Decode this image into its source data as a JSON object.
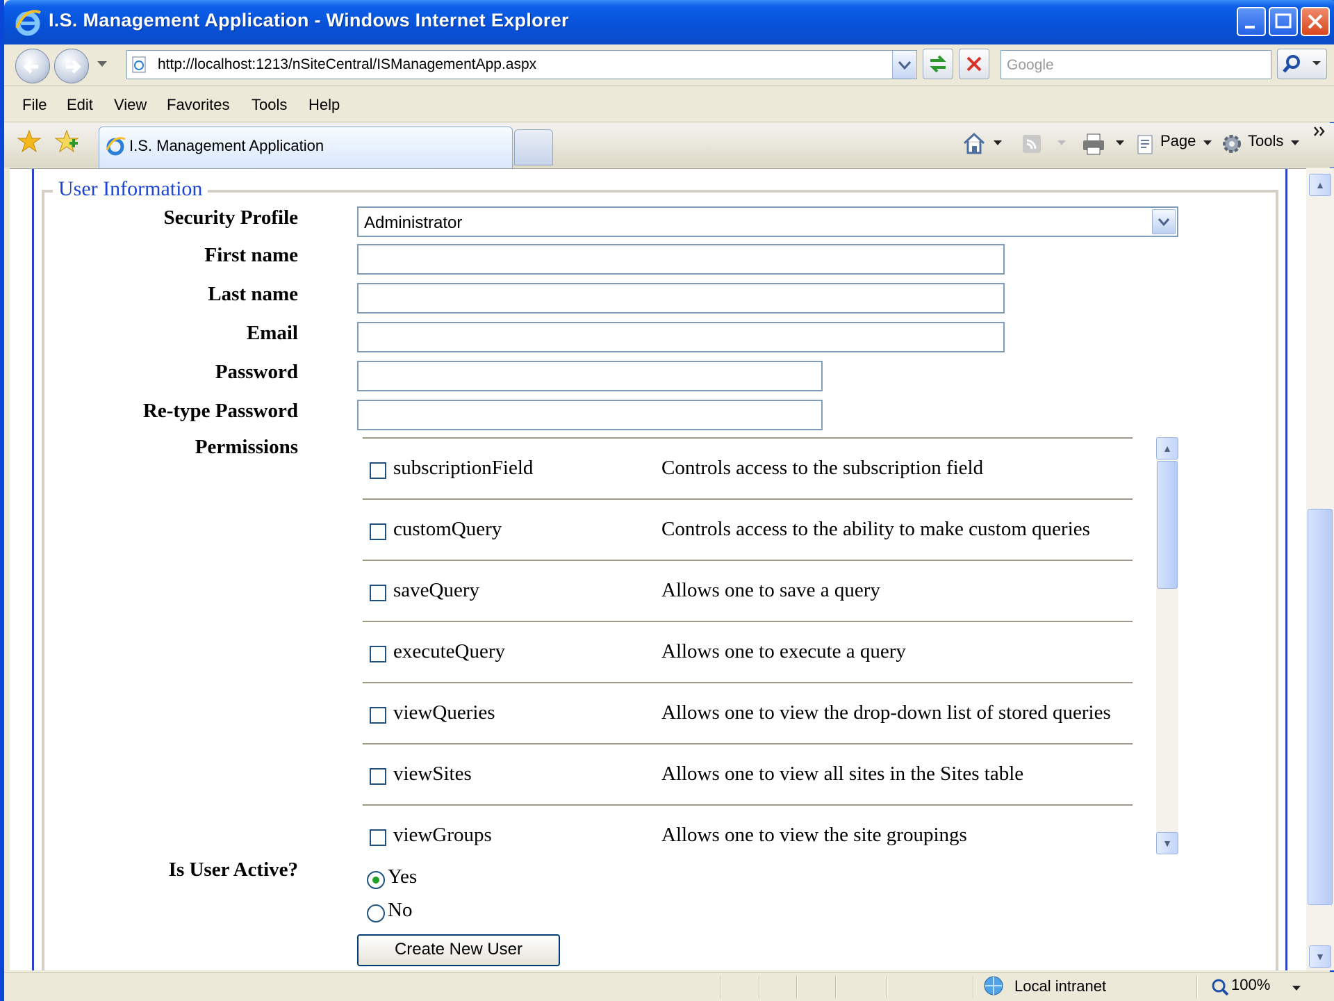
{
  "window": {
    "title": "I.S. Management Application - Windows Internet Explorer"
  },
  "address_bar": {
    "url": "http://localhost:1213/nSiteCentral/ISManagementApp.aspx"
  },
  "search": {
    "placeholder": "Google"
  },
  "menu": [
    "File",
    "Edit",
    "View",
    "Favorites",
    "Tools",
    "Help"
  ],
  "tab": {
    "title": "I.S. Management Application"
  },
  "command_bar": {
    "page_label": "Page",
    "tools_label": "Tools"
  },
  "form": {
    "legend": "User Information",
    "security_profile": {
      "label": "Security Profile",
      "selected": "Administrator"
    },
    "first_name": {
      "label": "First name",
      "value": ""
    },
    "last_name": {
      "label": "Last name",
      "value": ""
    },
    "email": {
      "label": "Email",
      "value": ""
    },
    "password": {
      "label": "Password",
      "value": ""
    },
    "retype_password": {
      "label": "Re-type Password",
      "value": ""
    },
    "permissions": {
      "label": "Permissions",
      "items": [
        {
          "name": "subscriptionField",
          "description": "Controls access to the subscription field",
          "checked": false
        },
        {
          "name": "customQuery",
          "description": "Controls access to the ability to make custom queries",
          "checked": false
        },
        {
          "name": "saveQuery",
          "description": "Allows one to save a query",
          "checked": false
        },
        {
          "name": "executeQuery",
          "description": "Allows one to execute a query",
          "checked": false
        },
        {
          "name": "viewQueries",
          "description": "Allows one to view the drop-down list of stored queries",
          "checked": false
        },
        {
          "name": "viewSites",
          "description": "Allows one to view all sites in the Sites table",
          "checked": false
        },
        {
          "name": "viewGroups",
          "description": "Allows one to view the site groupings",
          "checked": false
        }
      ]
    },
    "active": {
      "label": "Is User Active?",
      "options": [
        "Yes",
        "No"
      ],
      "selected": "Yes"
    },
    "submit_label": "Create New User"
  },
  "status_bar": {
    "zone": "Local intranet",
    "zoom": "100%"
  },
  "colors": {
    "legend": "#1d44d4",
    "titlebar": "#0751d8"
  }
}
